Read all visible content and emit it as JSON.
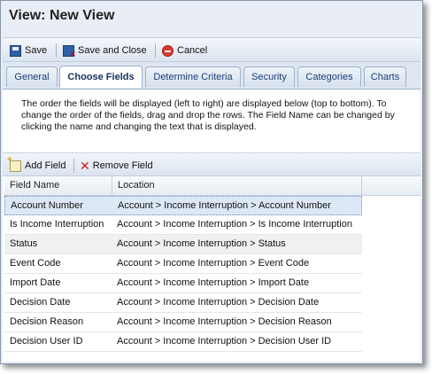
{
  "window": {
    "title": "View: New View"
  },
  "toolbar": {
    "save": "Save",
    "save_close": "Save and Close",
    "cancel": "Cancel"
  },
  "tabs": [
    {
      "label": "General"
    },
    {
      "label": "Choose Fields"
    },
    {
      "label": "Determine Criteria"
    },
    {
      "label": "Security"
    },
    {
      "label": "Categories"
    },
    {
      "label": "Charts"
    }
  ],
  "active_tab": "Choose Fields",
  "instructions": "The order the fields will be displayed (left to right) are displayed below (top to bottom). To change the order of the fields, drag and drop the rows. The Field Name can be changed by clicking the name and changing the text that is displayed.",
  "field_toolbar": {
    "add": "Add Field",
    "remove": "Remove Field"
  },
  "grid": {
    "columns": [
      "Field Name",
      "Location"
    ],
    "rows": [
      {
        "name": "Account Number",
        "location": "Account > Income Interruption > Account Number"
      },
      {
        "name": "Is Income Interruption",
        "location": "Account > Income Interruption > Is Income Interruption"
      },
      {
        "name": "Status",
        "location": "Account > Income Interruption > Status"
      },
      {
        "name": "Event Code",
        "location": "Account > Income Interruption > Event Code"
      },
      {
        "name": "Import Date",
        "location": "Account > Income Interruption > Import Date"
      },
      {
        "name": "Decision Date",
        "location": "Account > Income Interruption > Decision Date"
      },
      {
        "name": "Decision Reason",
        "location": "Account > Income Interruption > Decision Reason"
      },
      {
        "name": "Decision User ID",
        "location": "Account > Income Interruption > Decision User ID"
      }
    ]
  }
}
